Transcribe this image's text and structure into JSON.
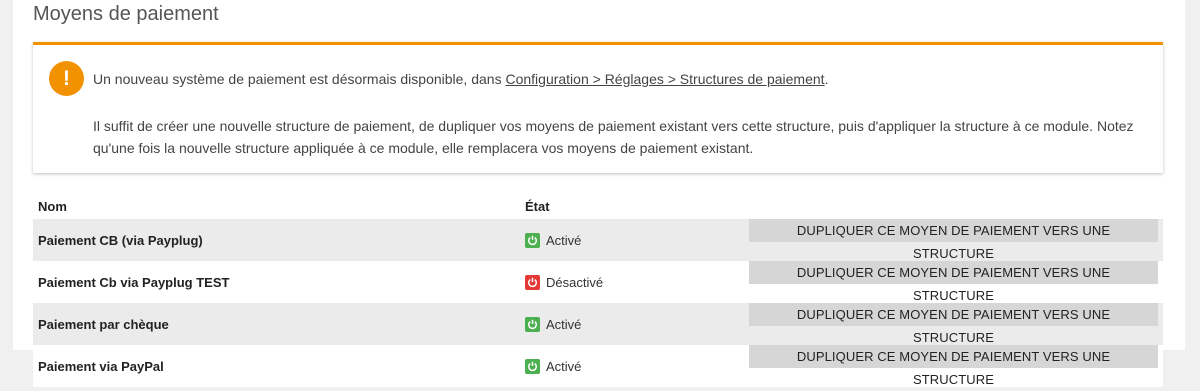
{
  "page": {
    "title": "Moyens de paiement"
  },
  "notice": {
    "line1_prefix": "Un nouveau système de paiement est désormais disponible, dans ",
    "line1_link": "Configuration > Réglages > Structures de paiement",
    "line1_suffix": ".",
    "paragraph": "Il suffit de créer une nouvelle structure de paiement, de dupliquer vos moyens de paiement existant vers cette structure, puis d'appliquer la structure à ce module. Notez qu'une fois la nouvelle structure appliquée à ce module, elle remplacera vos moyens de paiement existant."
  },
  "table": {
    "headers": {
      "name": "Nom",
      "state": "État"
    },
    "rows": [
      {
        "name": "Paiement CB (via Payplug)",
        "state": "Activé",
        "button": "DUPLIQUER CE MOYEN DE PAIEMENT VERS UNE STRUCTURE"
      },
      {
        "name": "Paiement Cb via Payplug TEST",
        "state": "Désactivé",
        "button": "DUPLIQUER CE MOYEN DE PAIEMENT VERS UNE STRUCTURE"
      },
      {
        "name": "Paiement par chèque",
        "state": "Activé",
        "button": "DUPLIQUER CE MOYEN DE PAIEMENT VERS UNE STRUCTURE"
      },
      {
        "name": "Paiement via PayPal",
        "state": "Activé",
        "button": "DUPLIQUER CE MOYEN DE PAIEMENT VERS UNE STRUCTURE"
      }
    ]
  },
  "colors": {
    "accent": "#f39200",
    "active": "#4caf50",
    "inactive": "#e53935"
  },
  "icons": {
    "notice": "exclamation-icon",
    "state": "power-icon"
  }
}
